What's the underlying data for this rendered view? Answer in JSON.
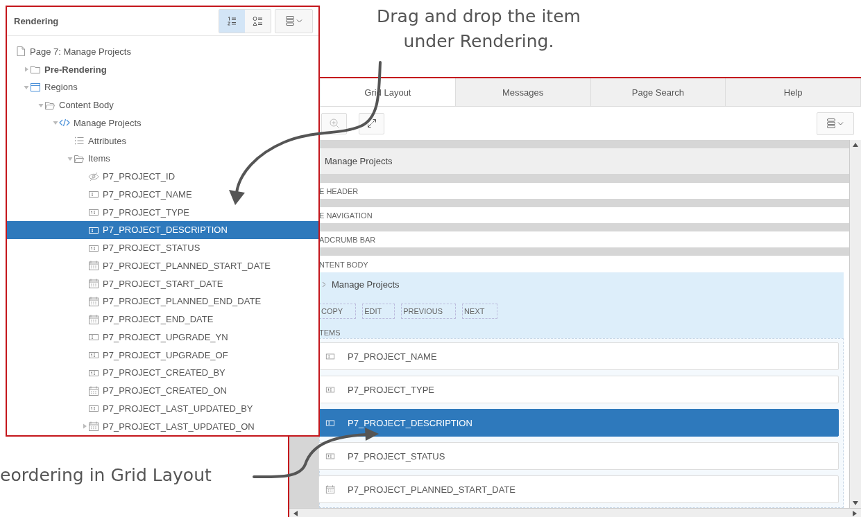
{
  "top_annotation": {
    "text": "Drag and drop the item\nunder Rendering."
  },
  "side_annotation": {
    "text": "eordering in Grid Layout"
  },
  "rendering_panel": {
    "title": "Rendering",
    "view_buttons": [
      {
        "kind": "numbered",
        "selected": true
      },
      {
        "kind": "shapes",
        "selected": false
      }
    ],
    "tree": [
      {
        "label": "Page 7: Manage Projects",
        "kind": "page",
        "selected": false,
        "children": [
          {
            "label": "Pre-Rendering",
            "kind": "folder",
            "bold": true,
            "expanded": false,
            "selected": false
          },
          {
            "label": "Regions",
            "kind": "region",
            "expanded": true,
            "selected": false,
            "children": [
              {
                "label": "Content Body",
                "kind": "folder-open",
                "expanded": true,
                "selected": false,
                "children": [
                  {
                    "label": "Manage Projects",
                    "kind": "code",
                    "expanded": true,
                    "selected": false,
                    "children": [
                      {
                        "label": "Attributes",
                        "kind": "list",
                        "selected": false
                      },
                      {
                        "label": "Items",
                        "kind": "folder-open",
                        "expanded": true,
                        "selected": false,
                        "children": [
                          {
                            "label": "P7_PROJECT_ID",
                            "kind": "hidden",
                            "selected": false
                          },
                          {
                            "label": "P7_PROJECT_NAME",
                            "kind": "text",
                            "selected": false
                          },
                          {
                            "label": "P7_PROJECT_TYPE",
                            "kind": "number",
                            "selected": false
                          },
                          {
                            "label": "P7_PROJECT_DESCRIPTION",
                            "kind": "text",
                            "selected": true
                          },
                          {
                            "label": "P7_PROJECT_STATUS",
                            "kind": "number",
                            "selected": false
                          },
                          {
                            "label": "P7_PROJECT_PLANNED_START_DATE",
                            "kind": "date",
                            "selected": false
                          },
                          {
                            "label": "P7_PROJECT_START_DATE",
                            "kind": "date",
                            "selected": false
                          },
                          {
                            "label": "P7_PROJECT_PLANNED_END_DATE",
                            "kind": "date",
                            "selected": false
                          },
                          {
                            "label": "P7_PROJECT_END_DATE",
                            "kind": "date",
                            "selected": false
                          },
                          {
                            "label": "P7_PROJECT_UPGRADE_YN",
                            "kind": "text",
                            "selected": false
                          },
                          {
                            "label": "P7_PROJECT_UPGRADE_OF",
                            "kind": "number",
                            "selected": false
                          },
                          {
                            "label": "P7_PROJECT_CREATED_BY",
                            "kind": "number",
                            "selected": false
                          },
                          {
                            "label": "P7_PROJECT_CREATED_ON",
                            "kind": "date",
                            "selected": false
                          },
                          {
                            "label": "P7_PROJECT_LAST_UPDATED_BY",
                            "kind": "number",
                            "selected": false
                          },
                          {
                            "label": "P7_PROJECT_LAST_UPDATED_ON",
                            "kind": "date",
                            "expanded": false,
                            "selected": false
                          }
                        ]
                      }
                    ]
                  }
                ]
              }
            ]
          }
        ]
      }
    ]
  },
  "grid_panel": {
    "tabs": [
      {
        "label": "Grid Layout",
        "selected": true
      },
      {
        "label": "Messages",
        "selected": false
      },
      {
        "label": "Page Search",
        "selected": false
      },
      {
        "label": "Help",
        "selected": false
      }
    ],
    "page_title": "Manage Projects",
    "page_rows": [
      {
        "label": "E HEADER"
      },
      {
        "label": "E NAVIGATION"
      },
      {
        "label": "ADCRUMB BAR"
      }
    ],
    "section_label": "NTENT BODY",
    "region": {
      "title": "Manage Projects",
      "buttons": [
        "COPY",
        "EDIT",
        "PREVIOUS",
        "NEXT"
      ],
      "items_label": "TEMS",
      "items": [
        {
          "label": "P7_PROJECT_NAME",
          "kind": "text",
          "selected": false
        },
        {
          "label": "P7_PROJECT_TYPE",
          "kind": "number",
          "selected": false
        },
        {
          "label": "P7_PROJECT_DESCRIPTION",
          "kind": "text",
          "selected": true
        },
        {
          "label": "P7_PROJECT_STATUS",
          "kind": "number",
          "selected": false
        },
        {
          "label": "P7_PROJECT_PLANNED_START_DATE",
          "kind": "date",
          "selected": false
        }
      ]
    }
  }
}
